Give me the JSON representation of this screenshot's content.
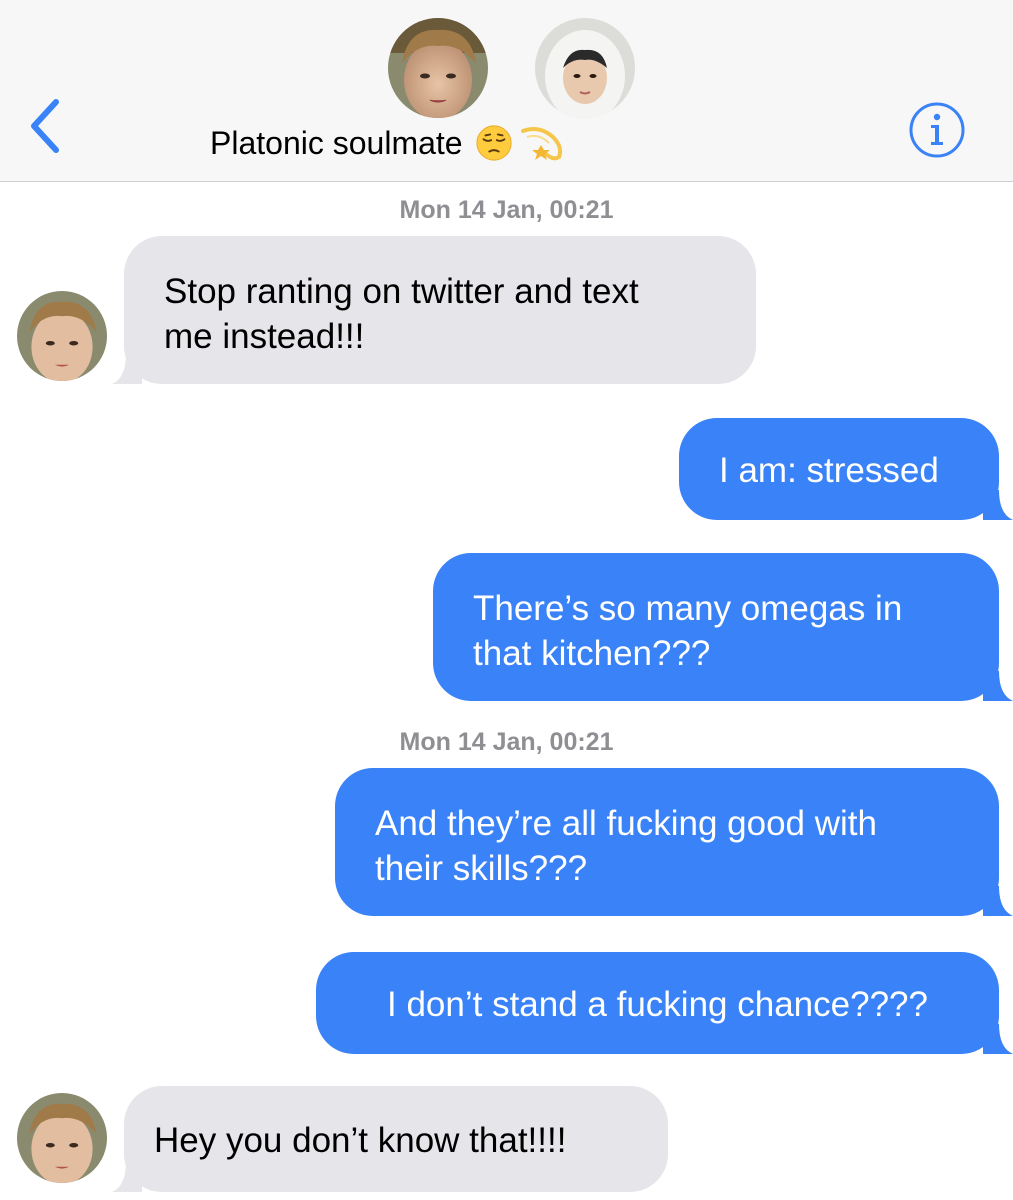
{
  "header": {
    "conversation_name": "Platonic soulmate",
    "emoji_1": "pensive-face",
    "emoji_2": "dizzy-star",
    "back_icon": "chevron-left-icon",
    "info_icon": "info-icon",
    "accent_color": "#3a82f7"
  },
  "messages": [
    {
      "type": "timestamp",
      "text": "Mon 14 Jan, 00:21"
    },
    {
      "type": "incoming",
      "text": "Stop ranting on twitter and text\nme instead!!!"
    },
    {
      "type": "outgoing",
      "text": "I am: stressed"
    },
    {
      "type": "outgoing",
      "text": "There’s so many omegas in\nthat kitchen???"
    },
    {
      "type": "timestamp",
      "text": "Mon 14 Jan, 00:21"
    },
    {
      "type": "outgoing",
      "text": "And they’re all fucking good with\ntheir skills???"
    },
    {
      "type": "outgoing",
      "text": "I don’t stand a fucking chance????"
    },
    {
      "type": "incoming",
      "text": "Hey you don’t know that!!!!"
    }
  ],
  "colors": {
    "incoming_bubble": "#e5e5ea",
    "outgoing_bubble": "#3a82f7",
    "timestamp": "#8e8e93"
  }
}
